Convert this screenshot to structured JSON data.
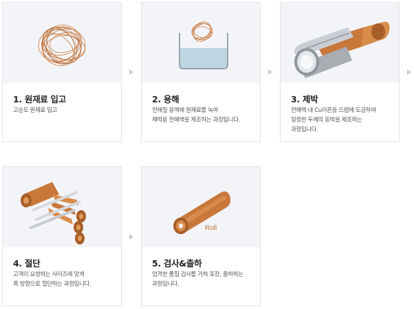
{
  "steps": [
    {
      "title": "1. 원재료 입고",
      "desc_lines": [
        "고순도 원재료 입고"
      ]
    },
    {
      "title": "2. 용해",
      "desc_lines": [
        "전해질 용액에 원재료를 녹여",
        "제박용 전해액을 제조하는 과정입니다."
      ]
    },
    {
      "title": "3. 제박",
      "desc_lines": [
        "전해액 내 Cu이온을 드럼에 도금하여",
        "일정한 두께의 동박을 제조하는",
        "과정입니다."
      ]
    },
    {
      "title": "4. 절단",
      "desc_lines": [
        "고객이 요청하는 사이즈에 맞게",
        "폭 방향으로 절단하는 과정입니다."
      ]
    },
    {
      "title": "5. 검사&출하",
      "desc_lines": [
        "엄격한 품질 검사를 거쳐 포장, 출하하는",
        "과정입니다."
      ]
    }
  ],
  "roll_label": "Roll",
  "icons": [
    "copper-wire-icon",
    "dissolving-tank-icon",
    "foil-drum-icon",
    "slitting-icon",
    "copper-roll-icon",
    "next-arrow-icon"
  ],
  "colors": {
    "copper": "#c8783a",
    "copper_light": "#e09a5a",
    "illustration_bg": "#f3f4f8",
    "arrow": "#c9c9c9"
  }
}
